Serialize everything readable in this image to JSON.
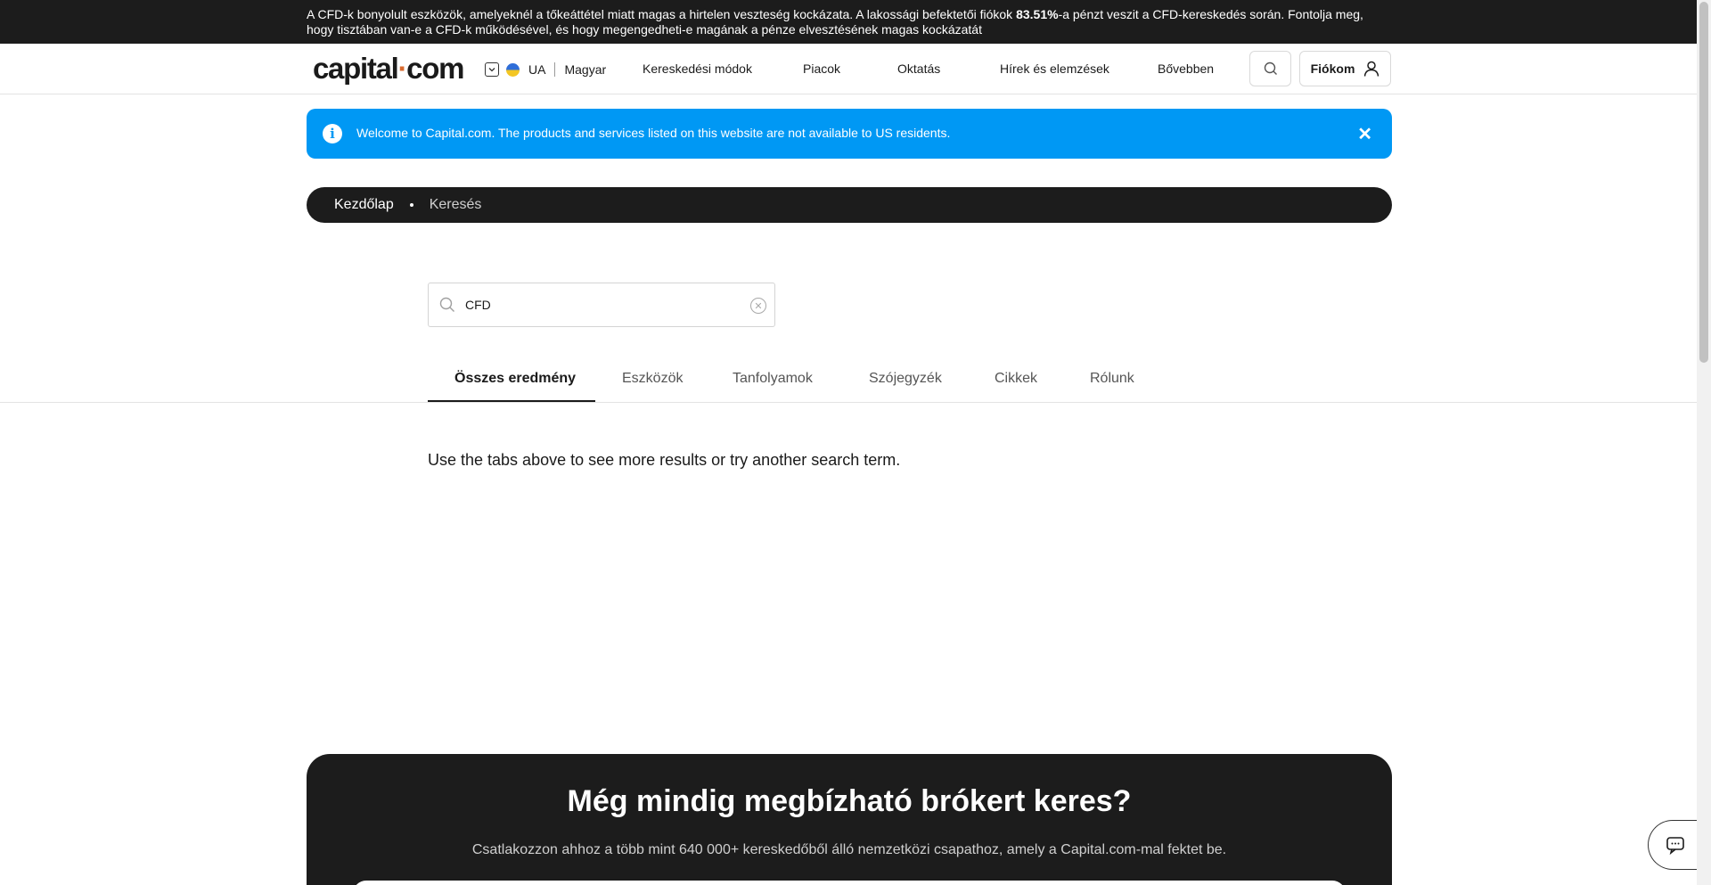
{
  "risk_warning": {
    "before": "A CFD-k bonyolult eszközök, amelyeknél a tőkeáttétel miatt magas a hirtelen veszteség kockázata. A lakossági befektetői fiókok ",
    "percent": "83.51%",
    "after": "-a pénzt veszit a CFD-kereskedés során. Fontolja meg, hogy tisztában van-e a CFD-k működésével, és hogy megengedheti-e magának a pénze elvesztésének magas kockázatát"
  },
  "header": {
    "logo_main": "capital",
    "logo_dot": "·",
    "logo_end": "com",
    "region_code": "UA",
    "language": "Magyar",
    "nav": [
      "Kereskedési módok",
      "Piacok",
      "Oktatás",
      "Hírek és elemzések",
      "Bővebben"
    ],
    "account_label": "Fiókom"
  },
  "notice": {
    "message": "Welcome to Capital.com. The products and services listed on this website are not available to US residents.",
    "info_symbol": "i",
    "close_symbol": "✕"
  },
  "breadcrumb": {
    "home": "Kezdőlap",
    "current": "Keresés"
  },
  "search": {
    "value": "CFD",
    "clear_symbol": "✕"
  },
  "tabs": [
    "Összes eredmény",
    "Eszközök",
    "Tanfolyamok",
    "Szójegyzék",
    "Cikkek",
    "Rólunk"
  ],
  "hint": "Use the tabs above to see more results or try another search term.",
  "promo": {
    "title": "Még mindig megbízható brókert keres?",
    "subtitle": "Csatlakozzon ahhoz a több mint 640 000+ kereskedőből álló nemzetközi csapathoz, amely a Capital.com-mal fektet be."
  },
  "colors": {
    "accent": "#0098f4",
    "dark": "#1c1c1c",
    "logo_dot": "#d96a2e"
  }
}
